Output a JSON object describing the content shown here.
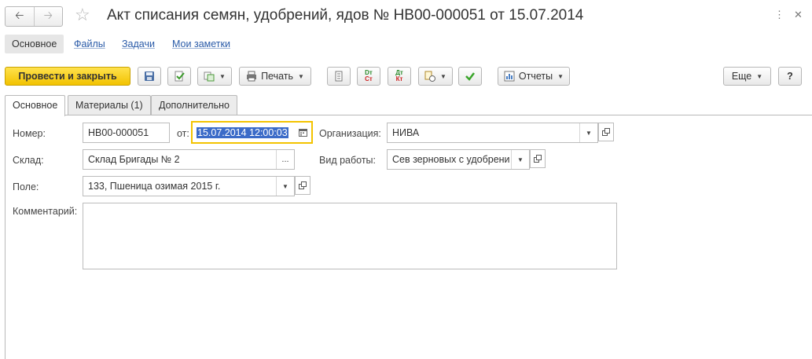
{
  "window": {
    "title": "Акт списания семян, удобрений, ядов № НВ00-000051 от 15.07.2014",
    "back": "🡠",
    "forward": "🡢",
    "favorite": "☆",
    "menu_icon": "⋮",
    "close_icon": "✕"
  },
  "sections": {
    "main": "Основное",
    "files": "Файлы",
    "tasks": "Задачи",
    "notes": "Мои заметки"
  },
  "toolbar": {
    "post_close": "Провести и закрыть",
    "print": "Печать",
    "reports": "Отчеты",
    "more": "Еще",
    "help": "?",
    "dt_top": "Dт",
    "dt_bottom": "Cт",
    "dtk_top": "Дт",
    "dtk_bottom": "Кт"
  },
  "tabs": [
    "Основное",
    "Материалы (1)",
    "Дополнительно"
  ],
  "form": {
    "number_label": "Номер:",
    "number_value": "НВ00-000051",
    "from_label": "от:",
    "date_value": "15.07.2014 12:00:03",
    "org_label": "Организация:",
    "org_value": "НИВА",
    "warehouse_label": "Склад:",
    "warehouse_value": "Склад Бригады № 2",
    "work_type_label": "Вид работы:",
    "work_type_value": "Сев зерновых с удобрени",
    "field_label": "Поле:",
    "field_value": "133, Пшеница озимая 2015 г.",
    "comment_label": "Комментарий:",
    "comment_value": "",
    "ellipsis": "..."
  },
  "colors": {
    "accent": "#f2c200",
    "link": "#2a5ba8",
    "selection": "#3b6bc8"
  }
}
